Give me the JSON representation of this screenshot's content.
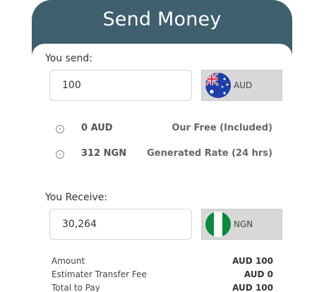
{
  "header": {
    "title": "Send Money"
  },
  "send": {
    "label": "You send:",
    "amount": "100",
    "currency": {
      "code": "AUD",
      "flag_icon": "australia-flag-icon"
    }
  },
  "fees": [
    {
      "value": "0 AUD",
      "label": "Our Free (Included)",
      "icon": "info-icon"
    },
    {
      "value": "312 NGN",
      "label": "Generated Rate (24 hrs)",
      "icon": "info-icon"
    }
  ],
  "receive": {
    "label": "You Receive:",
    "amount": "30,264",
    "currency": {
      "code": "NGN",
      "flag_icon": "nigeria-flag-icon"
    }
  },
  "summary": [
    {
      "label": "Amount",
      "value": "AUD 100"
    },
    {
      "label": "Estimater Transfer Fee",
      "value": "AUD 0"
    },
    {
      "label": "Total to Pay",
      "value": "AUD 100"
    }
  ],
  "colors": {
    "header_bg": "#3e5f6d",
    "currency_bg": "#d8d8d8"
  }
}
